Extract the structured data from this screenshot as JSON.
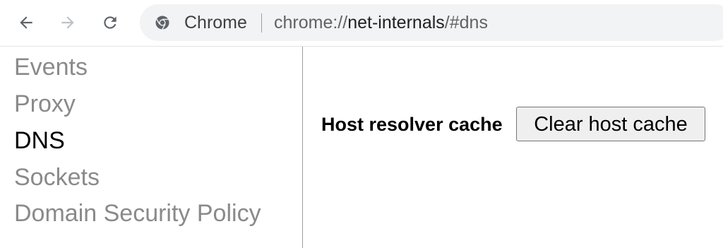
{
  "browser": {
    "site_label": "Chrome",
    "url_scheme": "chrome://",
    "url_host": "net-internals",
    "url_path": "/#dns",
    "icons": {
      "back": "back-arrow-icon",
      "forward": "forward-arrow-icon",
      "reload": "reload-icon",
      "site": "chrome-logo-icon"
    }
  },
  "sidebar": {
    "items": [
      {
        "label": "Events",
        "active": false
      },
      {
        "label": "Proxy",
        "active": false
      },
      {
        "label": "DNS",
        "active": true
      },
      {
        "label": "Sockets",
        "active": false
      },
      {
        "label": "Domain Security Policy",
        "active": false
      }
    ]
  },
  "dns": {
    "cache_label": "Host resolver cache",
    "clear_button_label": "Clear host cache"
  },
  "colors": {
    "inactive_nav": "#8a8a8a",
    "active_nav": "#000000",
    "omnibox_bg": "#f1f3f4"
  }
}
